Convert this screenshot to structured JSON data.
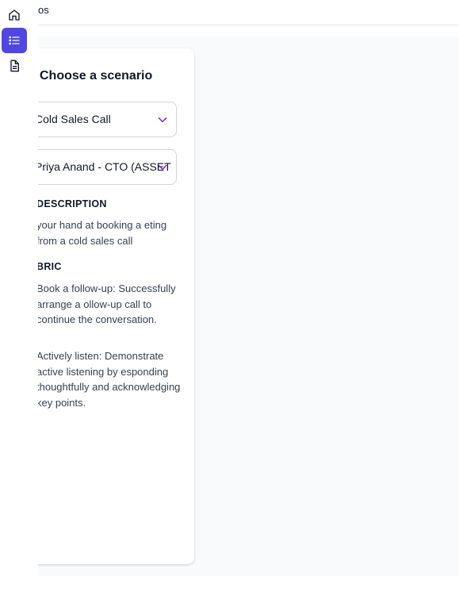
{
  "header": {
    "title": "os"
  },
  "panel": {
    "title": "Choose a scenario",
    "scenario_select": {
      "value": "Cold Sales Call"
    },
    "persona_select": {
      "value": "Priya Anand - CTO (ASSET"
    },
    "description": {
      "heading": "DESCRIPTION",
      "text": "your hand at booking a eting from a cold sales call"
    },
    "rubric": {
      "heading": "BRIC",
      "items": [
        {
          "text": "Book a follow-up: Successfully arrange a ollow-up call to continue the conversation."
        },
        {
          "text": "Actively listen: Demonstrate active listening by esponding thoughtfully and acknowledging key points."
        }
      ]
    }
  },
  "colors": {
    "accent": "#4f46e5",
    "chevron": "#6d28d9"
  }
}
